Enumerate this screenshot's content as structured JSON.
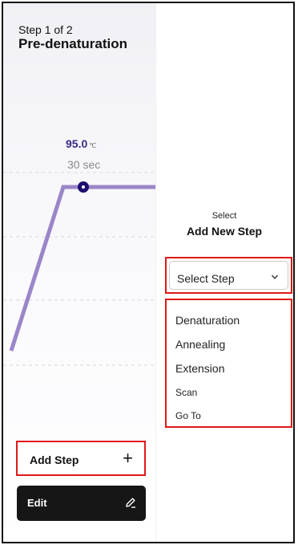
{
  "header": {
    "step_counter": "Step 1 of 2",
    "step_title": "Pre-denaturation"
  },
  "profile": {
    "temperature": "95.0",
    "temperature_unit": "℃",
    "duration": "30 sec",
    "line_color": "#9a86c8",
    "point_color": "#1c0e6e"
  },
  "actions": {
    "add_step_label": "Add Step",
    "edit_label": "Edit"
  },
  "add_panel": {
    "subtitle": "Select",
    "title": "Add New Step",
    "select_value": "Select Step",
    "options": [
      "Denaturation",
      "Annealing",
      "Extension",
      "Scan",
      "Go To"
    ]
  },
  "icons": {
    "add": "plus-icon",
    "edit": "pencil-icon",
    "dropdown": "chevron-down-icon"
  },
  "colors": {
    "highlight_border": "#e01818",
    "temperature_text": "#3b2a86",
    "edit_button_bg": "#161616"
  }
}
